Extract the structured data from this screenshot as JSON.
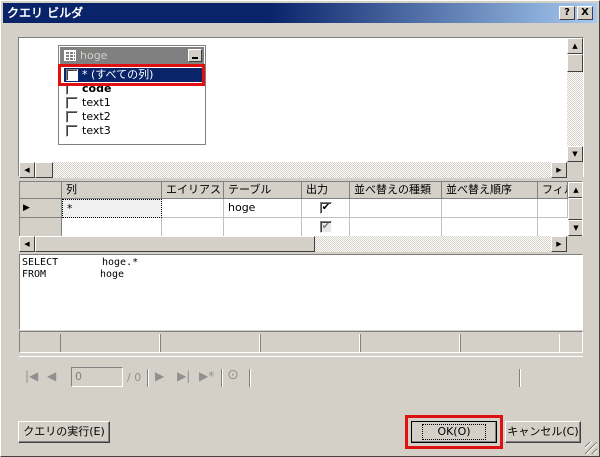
{
  "window": {
    "title": "クエリ ビルダ",
    "help_label": "?",
    "close_label": "X"
  },
  "table_window": {
    "title": "hoge",
    "columns": [
      {
        "label": "* (すべての列)",
        "checked": true,
        "selected": true
      },
      {
        "label": "code",
        "checked": false,
        "bold": true
      },
      {
        "label": "text1",
        "checked": false
      },
      {
        "label": "text2",
        "checked": false
      },
      {
        "label": "text3",
        "checked": false
      }
    ]
  },
  "grid": {
    "headers": [
      "列",
      "エイリアス",
      "テーブル",
      "出力",
      "並べ替えの種類",
      "並べ替え順序",
      "フィル"
    ],
    "rows": [
      {
        "column": "*",
        "alias": "",
        "table": "hoge",
        "output": true,
        "current": true
      },
      {
        "column": "",
        "alias": "",
        "table": "",
        "output": true,
        "current": false
      }
    ]
  },
  "sql": {
    "line1_keyword": "SELECT",
    "line1_value": "hoge.*",
    "line2_keyword": "FROM",
    "line2_value": "hoge"
  },
  "navigator": {
    "position_value": "0",
    "total_label": "/ 0"
  },
  "buttons": {
    "execute": "クエリの実行(E)",
    "ok": "OK(O)",
    "cancel": "キャンセル(C)"
  },
  "highlight_color": "#e01010"
}
